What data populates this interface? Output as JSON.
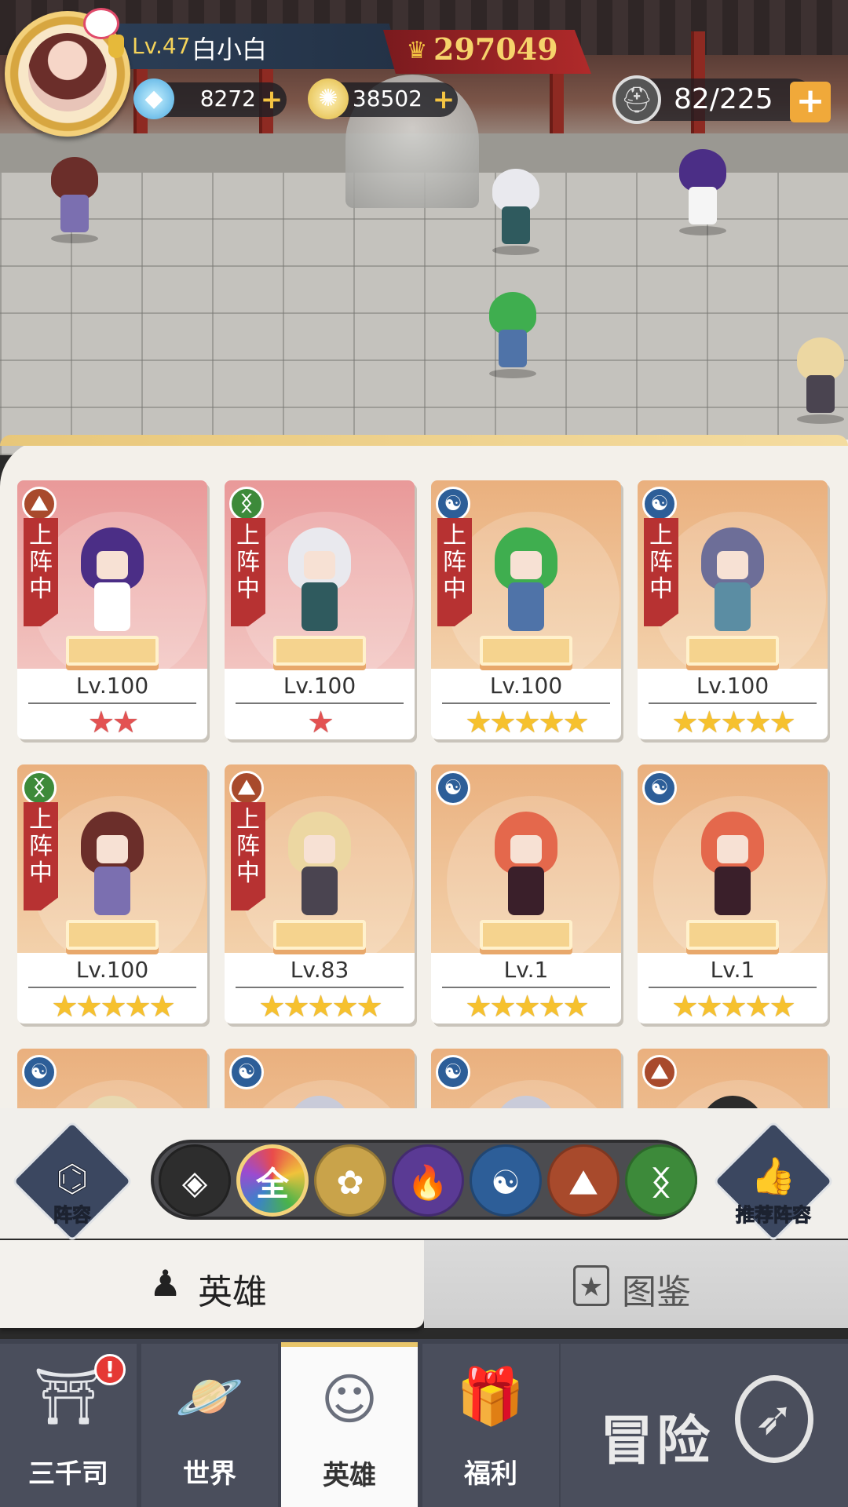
{
  "player": {
    "level": "Lv.47",
    "name": "白小白",
    "power": "297049"
  },
  "resources": {
    "diamonds": "8272",
    "coins": "38502",
    "plus": "+",
    "stamina": "82/225"
  },
  "heroes": [
    {
      "level": "Lv.100",
      "stars": "★★",
      "star_color": "red",
      "badge": "上阵中",
      "faction": "shield",
      "bg": "red",
      "hair": "#4b2e86",
      "outfit": "#ffffff"
    },
    {
      "level": "Lv.100",
      "stars": "★",
      "star_color": "red",
      "badge": "上阵中",
      "faction": "dna",
      "bg": "red",
      "hair": "#e9e9ee",
      "outfit": "#2f5a5e"
    },
    {
      "level": "Lv.100",
      "stars": "★★★★★",
      "star_color": "gold",
      "badge": "上阵中",
      "faction": "yinyang",
      "bg": "tan",
      "hair": "#3fae4f",
      "outfit": "#4f73a8"
    },
    {
      "level": "Lv.100",
      "stars": "★★★★★",
      "star_color": "gold",
      "badge": "上阵中",
      "faction": "yinyang",
      "bg": "tan",
      "hair": "#6d6e98",
      "outfit": "#5b8da3"
    },
    {
      "level": "Lv.100",
      "stars": "★★★★★",
      "star_color": "gold",
      "badge": "上阵中",
      "faction": "dna",
      "bg": "tan",
      "hair": "#6b2e2a",
      "outfit": "#7b6fb0"
    },
    {
      "level": "Lv.83",
      "stars": "★★★★★",
      "star_color": "gold",
      "badge": "上阵中",
      "faction": "shield",
      "bg": "tan",
      "hair": "#ecd7a2",
      "outfit": "#4a4450"
    },
    {
      "level": "Lv.1",
      "stars": "★★★★★",
      "star_color": "gold",
      "badge": "",
      "faction": "yinyang",
      "bg": "tan",
      "hair": "#e4684c",
      "outfit": "#3a1f2a"
    },
    {
      "level": "Lv.1",
      "stars": "★★★★★",
      "star_color": "gold",
      "badge": "",
      "faction": "yinyang",
      "bg": "tan",
      "hair": "#e4684c",
      "outfit": "#3a1f2a"
    },
    {
      "level": "",
      "stars": "",
      "star_color": "gold",
      "badge": "",
      "faction": "yinyang",
      "bg": "tan",
      "hair": "#e8d8b0",
      "outfit": "#ffffff"
    },
    {
      "level": "",
      "stars": "",
      "star_color": "gold",
      "badge": "",
      "faction": "yinyang",
      "bg": "tan",
      "hair": "#c9cbd9",
      "outfit": "#ffffff"
    },
    {
      "level": "",
      "stars": "",
      "star_color": "gold",
      "badge": "",
      "faction": "yinyang",
      "bg": "tan",
      "hair": "#c9cbd9",
      "outfit": "#ffffff"
    },
    {
      "level": "",
      "stars": "",
      "star_color": "gold",
      "badge": "",
      "faction": "shield",
      "bg": "tan",
      "hair": "#2b2b2b",
      "outfit": "#ffffff"
    }
  ],
  "filter": {
    "lineup_label": "阵容",
    "recommend_label": "推荐阵容",
    "all_label": "全",
    "factions": [
      "diamond-icon",
      "all",
      "lotus-icon",
      "flame-icon",
      "yinyang-icon",
      "shield-icon",
      "dna-icon"
    ],
    "colors": [
      "#2d2d2d",
      "#b89a4b",
      "#c9a34a",
      "#5a3a94",
      "#2d5e98",
      "#a84a2c",
      "#3d8a3a"
    ]
  },
  "tabs": {
    "hero": "英雄",
    "codex": "图鉴"
  },
  "nav": {
    "sanqiansi": "三千司",
    "world": "世界",
    "hero": "英雄",
    "welfare": "福利",
    "adventure": "冒险",
    "alert": "!"
  }
}
